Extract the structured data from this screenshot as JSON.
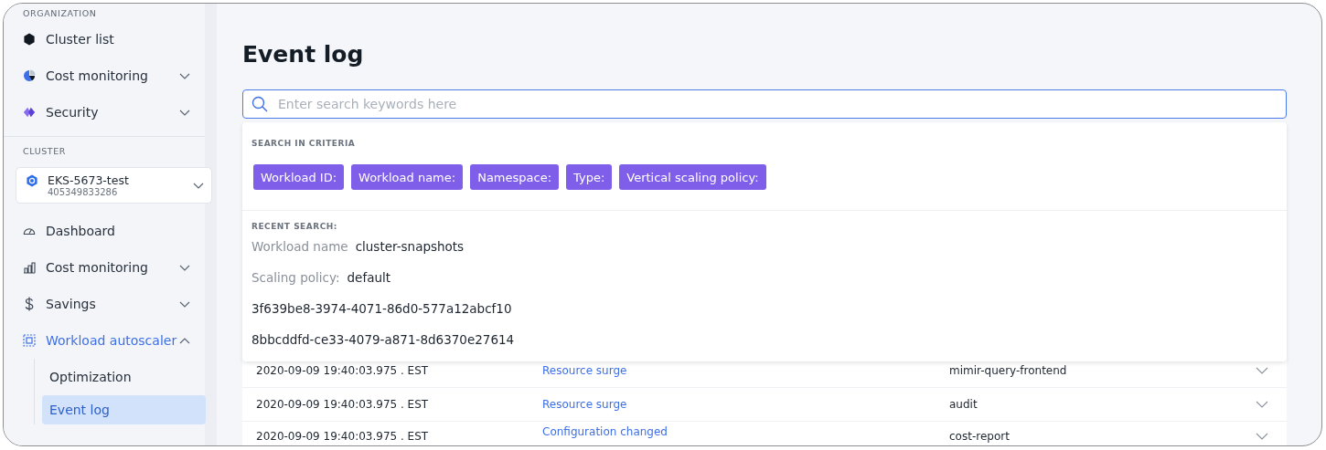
{
  "sidebar": {
    "sections": [
      {
        "heading": "ORGANIZATION",
        "items": [
          {
            "label": "Cluster list",
            "kind": "link",
            "selected": false
          },
          {
            "label": "Cost monitoring",
            "kind": "group",
            "expanded": false,
            "selected": false
          },
          {
            "label": "Security",
            "kind": "group",
            "expanded": false,
            "selected": false
          }
        ]
      },
      {
        "heading": "CLUSTER",
        "cluster": {
          "name": "EKS-5673-test",
          "account": "405349833286"
        },
        "items": [
          {
            "label": "Dashboard",
            "kind": "link",
            "selected": false
          },
          {
            "label": "Cost monitoring",
            "kind": "group",
            "expanded": false,
            "selected": false
          },
          {
            "label": "Savings",
            "kind": "group",
            "expanded": false,
            "selected": false
          },
          {
            "label": "Workload autoscaler",
            "kind": "group",
            "expanded": true,
            "selected": true,
            "children": [
              {
                "label": "Optimization",
                "selected": false
              },
              {
                "label": "Event log",
                "selected": true
              }
            ]
          }
        ]
      }
    ]
  },
  "page": {
    "title": "Event log"
  },
  "search": {
    "placeholder": "Enter search keywords here",
    "dropdown": {
      "criteria_heading": "SEARCH IN CRITERIA",
      "criteria": [
        "Workload ID:",
        "Workload name:",
        "Namespace:",
        "Type:",
        "Vertical scaling policy:"
      ],
      "recent_heading": "RECENT SEARCH:",
      "recent": [
        {
          "key": "Workload name",
          "value": "cluster-snapshots"
        },
        {
          "key": "Scaling policy:",
          "value": "default"
        },
        {
          "value": "3f639be8-3974-4071-86d0-577a12abcf10"
        },
        {
          "value": "8bbcddfd-ce33-4079-a871-8d6370e27614"
        }
      ]
    }
  },
  "table": {
    "rows": [
      {
        "time": "2020-09-09 19:40:03.975 . EST",
        "event": "Resource surge",
        "workload": "mimir-query-frontend"
      },
      {
        "time": "2020-09-09 19:40:03.975 . EST",
        "event": "Resource surge",
        "workload": "audit"
      },
      {
        "time": "2020-09-09 19:40:03.975 . EST",
        "event": "Configuration changed",
        "workload": "cost-report"
      }
    ]
  }
}
